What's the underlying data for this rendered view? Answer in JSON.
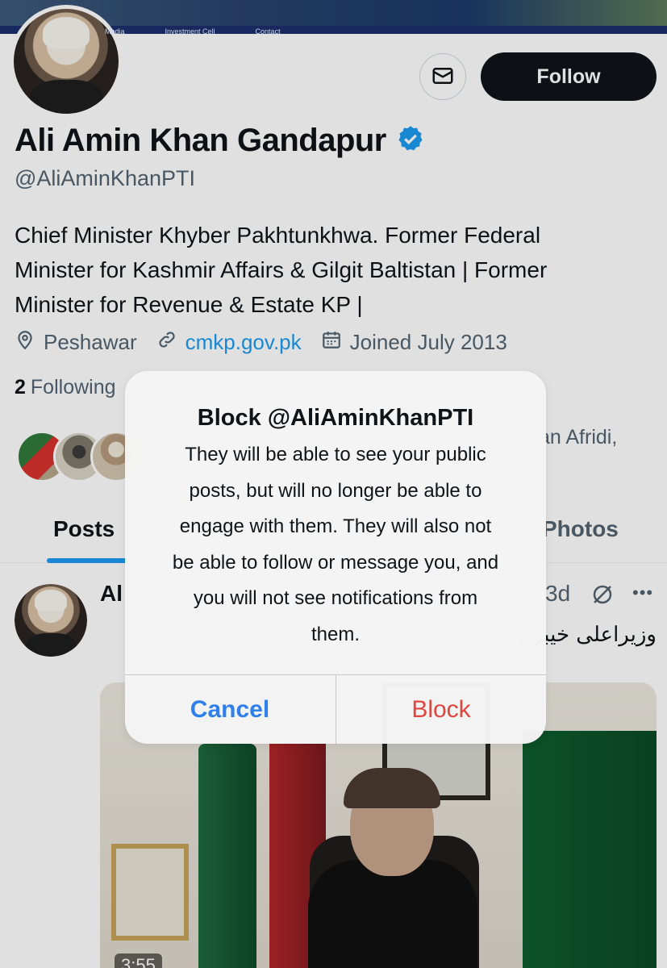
{
  "banner": {
    "nav": [
      "Media",
      "Investment Cell",
      "Contact"
    ]
  },
  "profile": {
    "display_name": "Ali Amin Khan Gandapur",
    "handle": "@AliAminKhanPTI",
    "bio_lines": [
      "Chief Minister Khyber Pakhtunkhwa. Former Federal",
      "Minister for Kashmir Affairs & Gilgit Baltistan | Former",
      "Minister for Revenue & Estate KP |"
    ],
    "location": "Peshawar",
    "website": "cmkp.gov.pk",
    "joined": "Joined July 2013",
    "following_count": "2",
    "following_label": "Following",
    "mutual_followers_text": "an Afridi,"
  },
  "actions": {
    "follow_label": "Follow"
  },
  "tabs": {
    "posts": "Posts",
    "photos": "Photos"
  },
  "post": {
    "author_partial": "Al",
    "time": "3d",
    "text_partial": "وزیراعلی خیبر پخ",
    "video_time": "3:55"
  },
  "dialog": {
    "title": "Block @AliAminKhanPTI",
    "body_lines": [
      "They will be able to see your public",
      "posts, but will no longer be able to",
      "engage with them. They will also not",
      "be able to follow or message you, and",
      "you will not see notifications from",
      "them."
    ],
    "cancel_label": "Cancel",
    "block_label": "Block"
  },
  "colors": {
    "accent": "#1d9bf0",
    "cancel": "#2f80ed",
    "block": "#e0463e",
    "text_secondary": "#536471"
  }
}
